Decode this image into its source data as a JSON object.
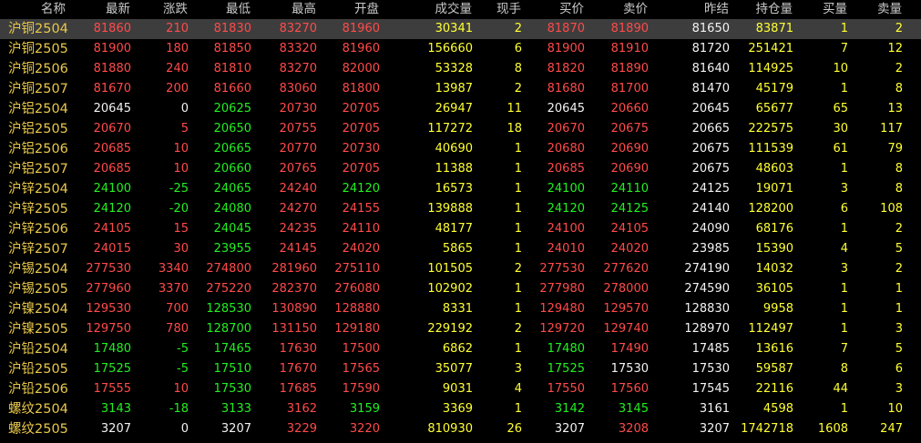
{
  "headers": [
    "名称",
    "最新",
    "涨跌",
    "最低",
    "最高",
    "开盘",
    "成交量",
    "现手",
    "买价",
    "卖价",
    "昨结",
    "持仓量",
    "买量",
    "卖量"
  ],
  "colors": {
    "up": "#ff4a4a",
    "down": "#22ee22",
    "flat": "#f2f2f2",
    "volume": "#ffff33",
    "name": "#e8c84a",
    "header": "#c8c8c8",
    "selected_row": "#3d3d3d",
    "background": "#000000"
  },
  "rows": [
    {
      "name": "沪铜2504",
      "latest": "81860",
      "change": "210",
      "low": "81830",
      "high": "83270",
      "open": "81960",
      "volume": "30341",
      "hand": "2",
      "bid": "81870",
      "ask": "81890",
      "prev_settle": "81650",
      "oi": "83871",
      "bid_vol": "1",
      "ask_vol": "2",
      "selected": true
    },
    {
      "name": "沪铜2505",
      "latest": "81900",
      "change": "180",
      "low": "81850",
      "high": "83320",
      "open": "81960",
      "volume": "156660",
      "hand": "6",
      "bid": "81900",
      "ask": "81910",
      "prev_settle": "81720",
      "oi": "251421",
      "bid_vol": "7",
      "ask_vol": "12"
    },
    {
      "name": "沪铜2506",
      "latest": "81880",
      "change": "240",
      "low": "81810",
      "high": "83270",
      "open": "82000",
      "volume": "53328",
      "hand": "8",
      "bid": "81820",
      "ask": "81890",
      "prev_settle": "81640",
      "oi": "114925",
      "bid_vol": "10",
      "ask_vol": "2"
    },
    {
      "name": "沪铜2507",
      "latest": "81670",
      "change": "200",
      "low": "81660",
      "high": "83060",
      "open": "81800",
      "volume": "13987",
      "hand": "2",
      "bid": "81680",
      "ask": "81700",
      "prev_settle": "81470",
      "oi": "45179",
      "bid_vol": "1",
      "ask_vol": "8"
    },
    {
      "name": "沪铝2504",
      "latest": "20645",
      "change": "0",
      "low": "20625",
      "high": "20730",
      "open": "20705",
      "volume": "26947",
      "hand": "11",
      "bid": "20645",
      "ask": "20660",
      "prev_settle": "20645",
      "oi": "65677",
      "bid_vol": "65",
      "ask_vol": "13"
    },
    {
      "name": "沪铝2505",
      "latest": "20670",
      "change": "5",
      "low": "20650",
      "high": "20755",
      "open": "20705",
      "volume": "117272",
      "hand": "18",
      "bid": "20670",
      "ask": "20675",
      "prev_settle": "20665",
      "oi": "222575",
      "bid_vol": "30",
      "ask_vol": "117"
    },
    {
      "name": "沪铝2506",
      "latest": "20685",
      "change": "10",
      "low": "20665",
      "high": "20770",
      "open": "20730",
      "volume": "40690",
      "hand": "1",
      "bid": "20680",
      "ask": "20690",
      "prev_settle": "20675",
      "oi": "111539",
      "bid_vol": "61",
      "ask_vol": "79"
    },
    {
      "name": "沪铝2507",
      "latest": "20685",
      "change": "10",
      "low": "20660",
      "high": "20765",
      "open": "20705",
      "volume": "11388",
      "hand": "1",
      "bid": "20685",
      "ask": "20690",
      "prev_settle": "20675",
      "oi": "48603",
      "bid_vol": "1",
      "ask_vol": "8"
    },
    {
      "name": "沪锌2504",
      "latest": "24100",
      "change": "-25",
      "low": "24065",
      "high": "24240",
      "open": "24120",
      "volume": "16573",
      "hand": "1",
      "bid": "24100",
      "ask": "24110",
      "prev_settle": "24125",
      "oi": "19071",
      "bid_vol": "3",
      "ask_vol": "8"
    },
    {
      "name": "沪锌2505",
      "latest": "24120",
      "change": "-20",
      "low": "24080",
      "high": "24270",
      "open": "24155",
      "volume": "139888",
      "hand": "1",
      "bid": "24120",
      "ask": "24125",
      "prev_settle": "24140",
      "oi": "128200",
      "bid_vol": "6",
      "ask_vol": "108"
    },
    {
      "name": "沪锌2506",
      "latest": "24105",
      "change": "15",
      "low": "24045",
      "high": "24235",
      "open": "24110",
      "volume": "48177",
      "hand": "1",
      "bid": "24100",
      "ask": "24105",
      "prev_settle": "24090",
      "oi": "68176",
      "bid_vol": "1",
      "ask_vol": "2"
    },
    {
      "name": "沪锌2507",
      "latest": "24015",
      "change": "30",
      "low": "23955",
      "high": "24145",
      "open": "24020",
      "volume": "5865",
      "hand": "1",
      "bid": "24010",
      "ask": "24020",
      "prev_settle": "23985",
      "oi": "15390",
      "bid_vol": "4",
      "ask_vol": "5"
    },
    {
      "name": "沪锡2504",
      "latest": "277530",
      "change": "3340",
      "low": "274800",
      "high": "281960",
      "open": "275110",
      "volume": "101505",
      "hand": "2",
      "bid": "277530",
      "ask": "277620",
      "prev_settle": "274190",
      "oi": "14032",
      "bid_vol": "3",
      "ask_vol": "2"
    },
    {
      "name": "沪锡2505",
      "latest": "277960",
      "change": "3370",
      "low": "275220",
      "high": "282370",
      "open": "276080",
      "volume": "102902",
      "hand": "1",
      "bid": "277980",
      "ask": "278000",
      "prev_settle": "274590",
      "oi": "36105",
      "bid_vol": "1",
      "ask_vol": "1"
    },
    {
      "name": "沪镍2504",
      "latest": "129530",
      "change": "700",
      "low": "128530",
      "high": "130890",
      "open": "128880",
      "volume": "8331",
      "hand": "1",
      "bid": "129480",
      "ask": "129570",
      "prev_settle": "128830",
      "oi": "9958",
      "bid_vol": "1",
      "ask_vol": "1"
    },
    {
      "name": "沪镍2505",
      "latest": "129750",
      "change": "780",
      "low": "128700",
      "high": "131150",
      "open": "129180",
      "volume": "229192",
      "hand": "2",
      "bid": "129720",
      "ask": "129740",
      "prev_settle": "128970",
      "oi": "112497",
      "bid_vol": "1",
      "ask_vol": "3"
    },
    {
      "name": "沪铅2504",
      "latest": "17480",
      "change": "-5",
      "low": "17465",
      "high": "17630",
      "open": "17500",
      "volume": "6862",
      "hand": "1",
      "bid": "17480",
      "ask": "17490",
      "prev_settle": "17485",
      "oi": "13616",
      "bid_vol": "7",
      "ask_vol": "5"
    },
    {
      "name": "沪铅2505",
      "latest": "17525",
      "change": "-5",
      "low": "17510",
      "high": "17670",
      "open": "17565",
      "volume": "35077",
      "hand": "3",
      "bid": "17525",
      "ask": "17530",
      "prev_settle": "17530",
      "oi": "59587",
      "bid_vol": "8",
      "ask_vol": "6"
    },
    {
      "name": "沪铅2506",
      "latest": "17555",
      "change": "10",
      "low": "17530",
      "high": "17685",
      "open": "17590",
      "volume": "9031",
      "hand": "4",
      "bid": "17550",
      "ask": "17560",
      "prev_settle": "17545",
      "oi": "22116",
      "bid_vol": "44",
      "ask_vol": "3"
    },
    {
      "name": "螺纹2504",
      "latest": "3143",
      "change": "-18",
      "low": "3133",
      "high": "3162",
      "open": "3159",
      "volume": "3369",
      "hand": "1",
      "bid": "3142",
      "ask": "3145",
      "prev_settle": "3161",
      "oi": "4598",
      "bid_vol": "1",
      "ask_vol": "10"
    },
    {
      "name": "螺纹2505",
      "latest": "3207",
      "change": "0",
      "low": "3207",
      "high": "3229",
      "open": "3220",
      "volume": "810930",
      "hand": "26",
      "bid": "3207",
      "ask": "3208",
      "prev_settle": "3207",
      "oi": "1742718",
      "bid_vol": "1608",
      "ask_vol": "247"
    }
  ]
}
